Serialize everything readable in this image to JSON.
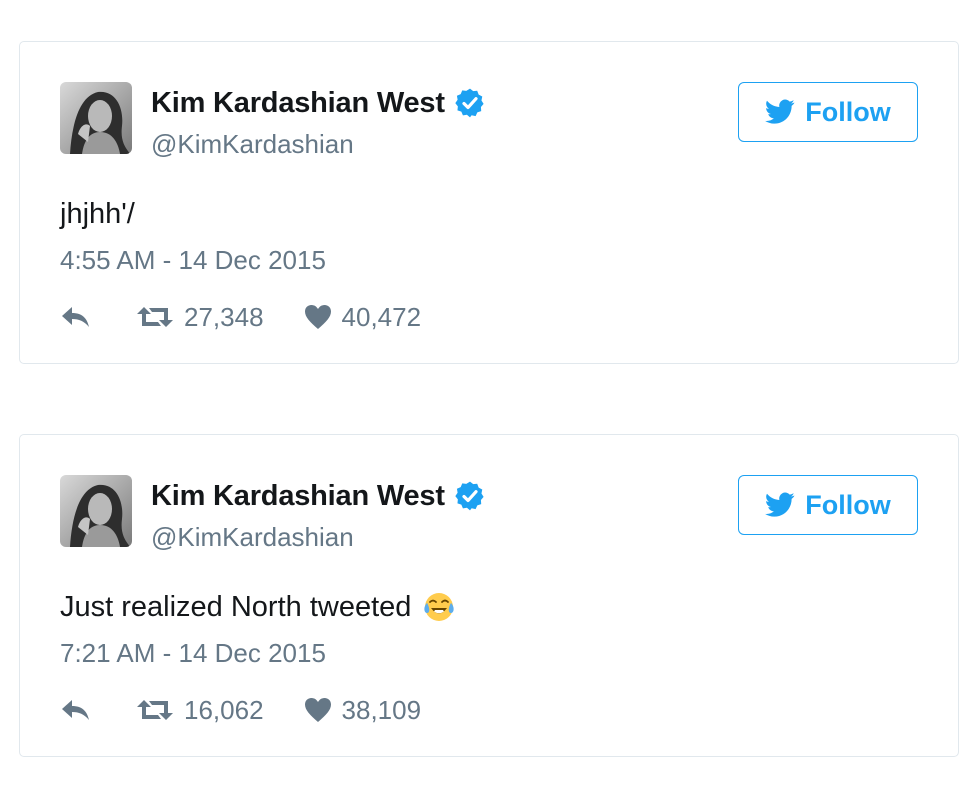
{
  "tweets": [
    {
      "name": "Kim Kardashian West",
      "handle": "@KimKardashian",
      "follow_label": "Follow",
      "text": "jhjhh'/",
      "has_emoji": false,
      "time": "4:55 AM - 14 Dec 2015",
      "retweets": "27,348",
      "likes": "40,472"
    },
    {
      "name": "Kim Kardashian West",
      "handle": "@KimKardashian",
      "follow_label": "Follow",
      "text": "Just realized North tweeted",
      "has_emoji": true,
      "emoji": "face-with-tears-of-joy-icon",
      "time": "7:21 AM - 14 Dec 2015",
      "retweets": "16,062",
      "likes": "38,109"
    }
  ],
  "colors": {
    "accent": "#1da1f2",
    "verified": "#1da1f2",
    "text": "#14171a",
    "muted": "#657786",
    "border": "#e1e8ed"
  }
}
